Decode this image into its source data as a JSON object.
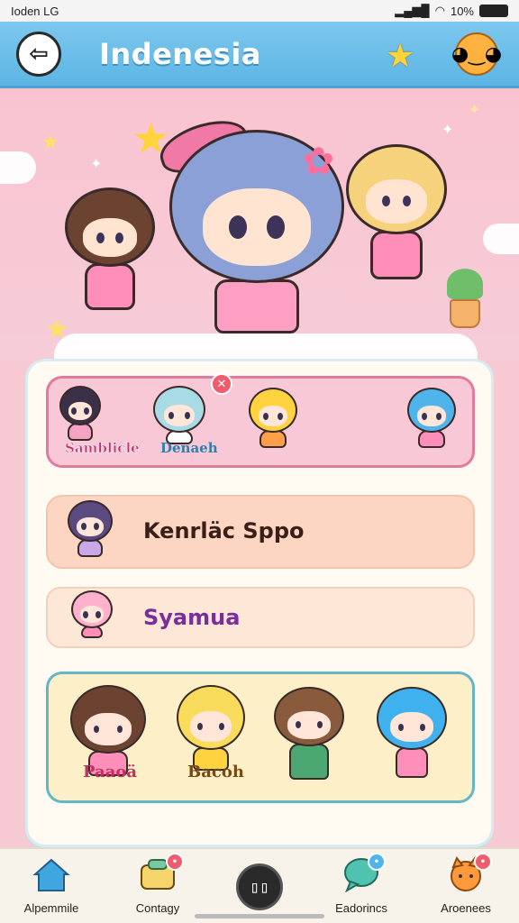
{
  "status_bar": {
    "carrier": "Ioden LG",
    "battery_pct": "10%"
  },
  "header": {
    "title": "Indenesia",
    "back_icon": "arrow-left-icon",
    "star_icon": "star-icon",
    "profile_icon": "fox-face-icon"
  },
  "list": {
    "row1": {
      "tags": [
        "Samblicle",
        "Denaeh"
      ]
    },
    "row2": {
      "label": "Kenrläc Sppo"
    },
    "row3": {
      "label": "Syamua"
    },
    "row4": {
      "tags": [
        "Paaoä",
        "Bacoh"
      ]
    }
  },
  "bottom_nav": [
    {
      "label": "Alpemmile",
      "icon": "house-icon"
    },
    {
      "label": "Contagy",
      "icon": "chat-box-icon"
    },
    {
      "label": "",
      "icon": "center-logo-icon"
    },
    {
      "label": "Eadorincs",
      "icon": "chat-bubble-icon"
    },
    {
      "label": "Aroenees",
      "icon": "fox-avatar-icon"
    }
  ],
  "colors": {
    "appbar": "#5db5e4",
    "hero_bg": "#f9c4d0",
    "row1_border": "#e27a9e",
    "row4_border": "#63b6c6"
  }
}
